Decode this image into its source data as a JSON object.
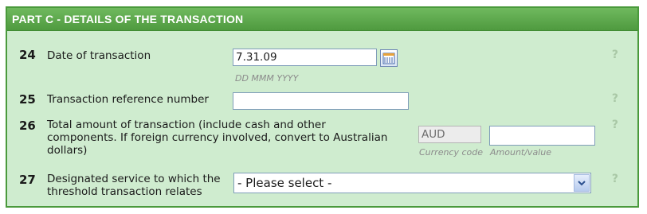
{
  "section": {
    "title": "PART C - DETAILS OF THE TRANSACTION"
  },
  "fields": [
    {
      "number": "24",
      "label": "Date of transaction",
      "value": "7.31.09",
      "hint": "DD MMM YYYY",
      "help": "?",
      "icon": "calendar-icon"
    },
    {
      "number": "25",
      "label": "Transaction reference number",
      "value": "",
      "help": "?"
    },
    {
      "number": "26",
      "label_lines": [
        "Total amount of transaction (include cash and other",
        "components. If foreign currency involved, convert to Australian",
        "dollars)"
      ],
      "currency_code": "AUD",
      "currency_hint": "Currency code",
      "amount_value": "",
      "amount_hint": "Amount/value",
      "help": "?"
    },
    {
      "number": "27",
      "label_lines": [
        "Designated service to which the",
        "threshold transaction relates"
      ],
      "select_value": "- Please select -",
      "help": "?",
      "icon": "chevron-down-icon"
    }
  ],
  "colors": {
    "header_bg": "#5aa84a",
    "panel_bg": "#cfeccf",
    "border": "#4a9a3c",
    "help": "#a9c8a6"
  }
}
